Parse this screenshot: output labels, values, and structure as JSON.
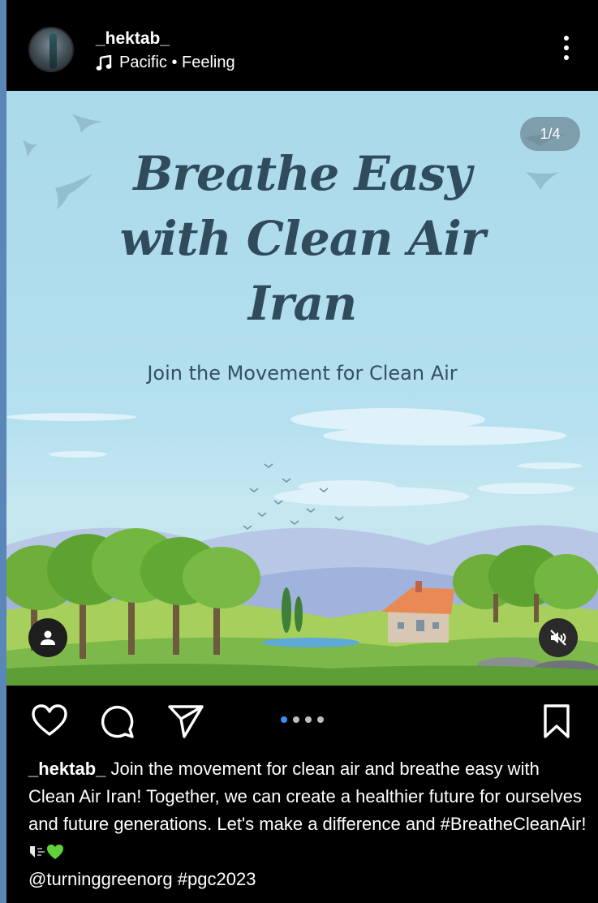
{
  "post": {
    "username": "_hektab_",
    "audio": "Pacific • Feeling",
    "headline_lines": [
      "Breathe Easy",
      "with Clean Air",
      "Iran"
    ],
    "subheading": "Join the Movement for Clean Air",
    "counter": "1/4",
    "carousel": {
      "total": 4,
      "active": 1
    }
  },
  "caption": {
    "username": "_hektab_",
    "text": "Join the movement for clean air and breathe easy with Clean Air Iran! Together, we can create a healthier future for ourselves and future generations. Let's make a difference and #BreatheCleanAir!",
    "tail": "@turninggreenorg #pgc2023"
  },
  "icons": [
    "music-note-icon",
    "more-options-icon",
    "user-tag-icon",
    "mute-icon",
    "heart-icon",
    "comment-icon",
    "share-icon",
    "bookmark-icon"
  ],
  "colors": {
    "background": "#000000",
    "accent": "#3d8ff2",
    "frame": "#5b86b8",
    "headline": "#2f4b5c"
  }
}
